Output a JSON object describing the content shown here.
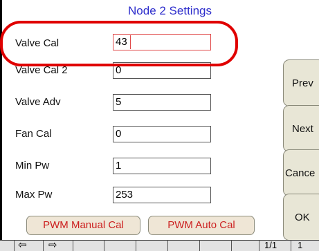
{
  "title": "Node 2 Settings",
  "fields": [
    {
      "label": "Valve Cal",
      "value": "43"
    },
    {
      "label": "Valve Cal 2",
      "value": "0"
    },
    {
      "label": "Valve Adv",
      "value": "5"
    },
    {
      "label": "Fan Cal",
      "value": "0"
    },
    {
      "label": "Min Pw",
      "value": "1"
    },
    {
      "label": "Max Pw",
      "value": "253"
    }
  ],
  "side_buttons": {
    "prev": "Prev",
    "next": "Next",
    "cancel": "Cance",
    "ok": "OK"
  },
  "bottom_buttons": {
    "manual": "PWM Manual Cal",
    "auto": "PWM Auto Cal"
  },
  "toolbar": {
    "page_indicator": "1/1",
    "trailing": "1"
  },
  "colors": {
    "title": "#2d2dcc",
    "highlight": "#e00000",
    "button_text": "#cc2020",
    "button_bg": "#e8e6d6"
  }
}
